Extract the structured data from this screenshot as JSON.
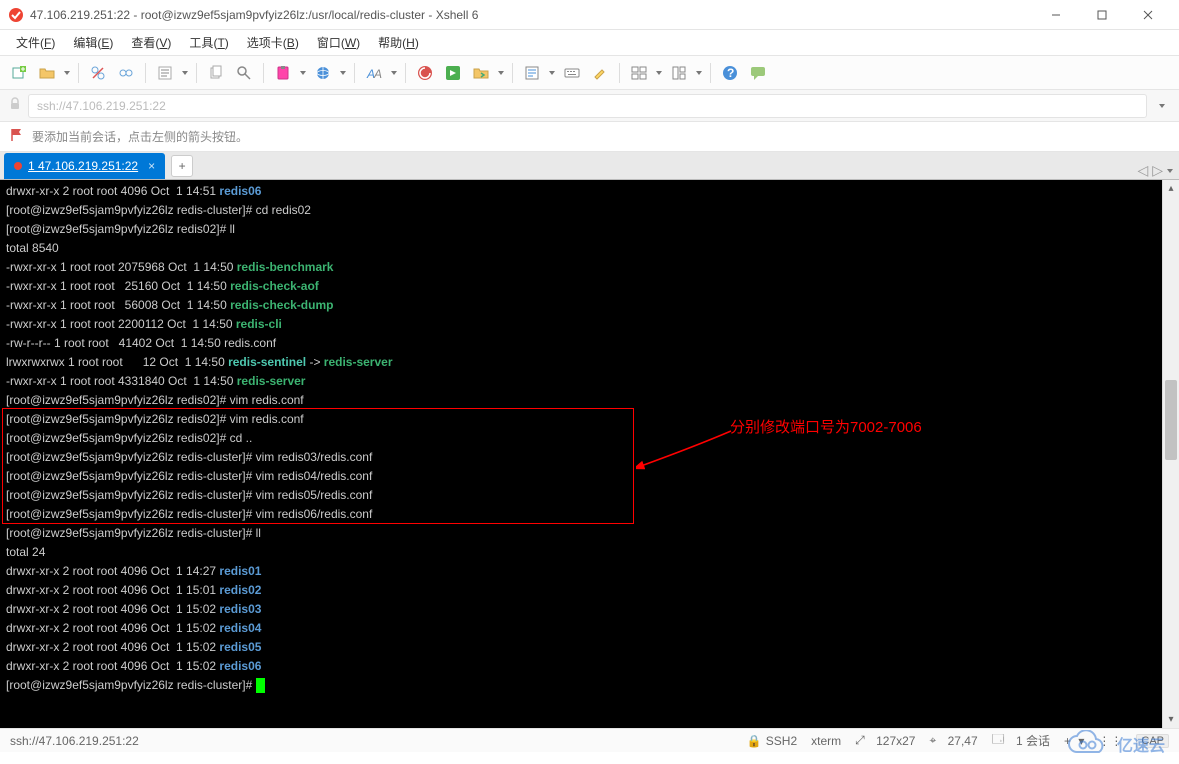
{
  "window": {
    "title": "47.106.219.251:22 - root@izwz9ef5sjam9pvfyiz26lz:/usr/local/redis-cluster - Xshell 6"
  },
  "menus": {
    "file": {
      "label": "文件",
      "accel": "F"
    },
    "edit": {
      "label": "编辑",
      "accel": "E"
    },
    "view": {
      "label": "查看",
      "accel": "V"
    },
    "tools": {
      "label": "工具",
      "accel": "T"
    },
    "tabs": {
      "label": "选项卡",
      "accel": "B"
    },
    "window": {
      "label": "窗口",
      "accel": "W"
    },
    "help": {
      "label": "帮助",
      "accel": "H"
    }
  },
  "address": {
    "text": "ssh://47.106.219.251:22"
  },
  "info": {
    "text": "要添加当前会话，点击左侧的箭头按钮。"
  },
  "tab": {
    "title": "1 47.106.219.251:22",
    "underline_index": 0
  },
  "annotation": {
    "text": "分别修改端口号为7002-7006"
  },
  "terminal": {
    "lines": [
      {
        "segs": [
          {
            "t": "drwxr-xr-x 2 root root 4096 Oct  1 14:51 ",
            "c": "w"
          },
          {
            "t": "redis06",
            "c": "b"
          }
        ]
      },
      {
        "segs": [
          {
            "t": "[root@izwz9ef5sjam9pvfyiz26lz redis-cluster]# cd redis02",
            "c": "w"
          }
        ]
      },
      {
        "segs": [
          {
            "t": "[root@izwz9ef5sjam9pvfyiz26lz redis02]# ll",
            "c": "w"
          }
        ]
      },
      {
        "segs": [
          {
            "t": "total 8540",
            "c": "w"
          }
        ]
      },
      {
        "segs": [
          {
            "t": "-rwxr-xr-x 1 root root 2075968 Oct  1 14:50 ",
            "c": "w"
          },
          {
            "t": "redis-benchmark",
            "c": "g"
          }
        ]
      },
      {
        "segs": [
          {
            "t": "-rwxr-xr-x 1 root root   25160 Oct  1 14:50 ",
            "c": "w"
          },
          {
            "t": "redis-check-aof",
            "c": "g"
          }
        ]
      },
      {
        "segs": [
          {
            "t": "-rwxr-xr-x 1 root root   56008 Oct  1 14:50 ",
            "c": "w"
          },
          {
            "t": "redis-check-dump",
            "c": "g"
          }
        ]
      },
      {
        "segs": [
          {
            "t": "-rwxr-xr-x 1 root root 2200112 Oct  1 14:50 ",
            "c": "w"
          },
          {
            "t": "redis-cli",
            "c": "g"
          }
        ]
      },
      {
        "segs": [
          {
            "t": "-rw-r--r-- 1 root root   41402 Oct  1 14:50 redis.conf",
            "c": "w"
          }
        ]
      },
      {
        "segs": [
          {
            "t": "lrwxrwxrwx 1 root root      12 Oct  1 14:50 ",
            "c": "w"
          },
          {
            "t": "redis-sentinel",
            "c": "cy"
          },
          {
            "t": " -> ",
            "c": "w"
          },
          {
            "t": "redis-server",
            "c": "g"
          }
        ]
      },
      {
        "segs": [
          {
            "t": "-rwxr-xr-x 1 root root 4331840 Oct  1 14:50 ",
            "c": "w"
          },
          {
            "t": "redis-server",
            "c": "g"
          }
        ]
      },
      {
        "segs": [
          {
            "t": "[root@izwz9ef5sjam9pvfyiz26lz redis02]# vim redis.conf",
            "c": "w"
          }
        ]
      },
      {
        "segs": [
          {
            "t": "[root@izwz9ef5sjam9pvfyiz26lz redis02]# vim redis.conf",
            "c": "w"
          }
        ]
      },
      {
        "segs": [
          {
            "t": "[root@izwz9ef5sjam9pvfyiz26lz redis02]# cd ..",
            "c": "w"
          }
        ]
      },
      {
        "segs": [
          {
            "t": "[root@izwz9ef5sjam9pvfyiz26lz redis-cluster]# vim redis03/redis.conf",
            "c": "w"
          }
        ]
      },
      {
        "segs": [
          {
            "t": "[root@izwz9ef5sjam9pvfyiz26lz redis-cluster]# vim redis04/redis.conf",
            "c": "w"
          }
        ]
      },
      {
        "segs": [
          {
            "t": "[root@izwz9ef5sjam9pvfyiz26lz redis-cluster]# vim redis05/redis.conf",
            "c": "w"
          }
        ]
      },
      {
        "segs": [
          {
            "t": "[root@izwz9ef5sjam9pvfyiz26lz redis-cluster]# vim redis06/redis.conf",
            "c": "w"
          }
        ]
      },
      {
        "segs": [
          {
            "t": "[root@izwz9ef5sjam9pvfyiz26lz redis-cluster]# ll",
            "c": "w"
          }
        ]
      },
      {
        "segs": [
          {
            "t": "total 24",
            "c": "w"
          }
        ]
      },
      {
        "segs": [
          {
            "t": "drwxr-xr-x 2 root root 4096 Oct  1 14:27 ",
            "c": "w"
          },
          {
            "t": "redis01",
            "c": "b"
          }
        ]
      },
      {
        "segs": [
          {
            "t": "drwxr-xr-x 2 root root 4096 Oct  1 15:01 ",
            "c": "w"
          },
          {
            "t": "redis02",
            "c": "b"
          }
        ]
      },
      {
        "segs": [
          {
            "t": "drwxr-xr-x 2 root root 4096 Oct  1 15:02 ",
            "c": "w"
          },
          {
            "t": "redis03",
            "c": "b"
          }
        ]
      },
      {
        "segs": [
          {
            "t": "drwxr-xr-x 2 root root 4096 Oct  1 15:02 ",
            "c": "w"
          },
          {
            "t": "redis04",
            "c": "b"
          }
        ]
      },
      {
        "segs": [
          {
            "t": "drwxr-xr-x 2 root root 4096 Oct  1 15:02 ",
            "c": "w"
          },
          {
            "t": "redis05",
            "c": "b"
          }
        ]
      },
      {
        "segs": [
          {
            "t": "drwxr-xr-x 2 root root 4096 Oct  1 15:02 ",
            "c": "w"
          },
          {
            "t": "redis06",
            "c": "b"
          }
        ]
      },
      {
        "segs": [
          {
            "t": "[root@izwz9ef5sjam9pvfyiz26lz redis-cluster]# ",
            "c": "w"
          }
        ],
        "cursor": true
      }
    ]
  },
  "status": {
    "left": "ssh://47.106.219.251:22",
    "proto": "SSH2",
    "term": "xterm",
    "size": "127x27",
    "pos": "27,47",
    "sessions_label": "1 会话",
    "cap": "CAP",
    "plus": "+"
  },
  "watermark": {
    "text": "亿速云"
  }
}
